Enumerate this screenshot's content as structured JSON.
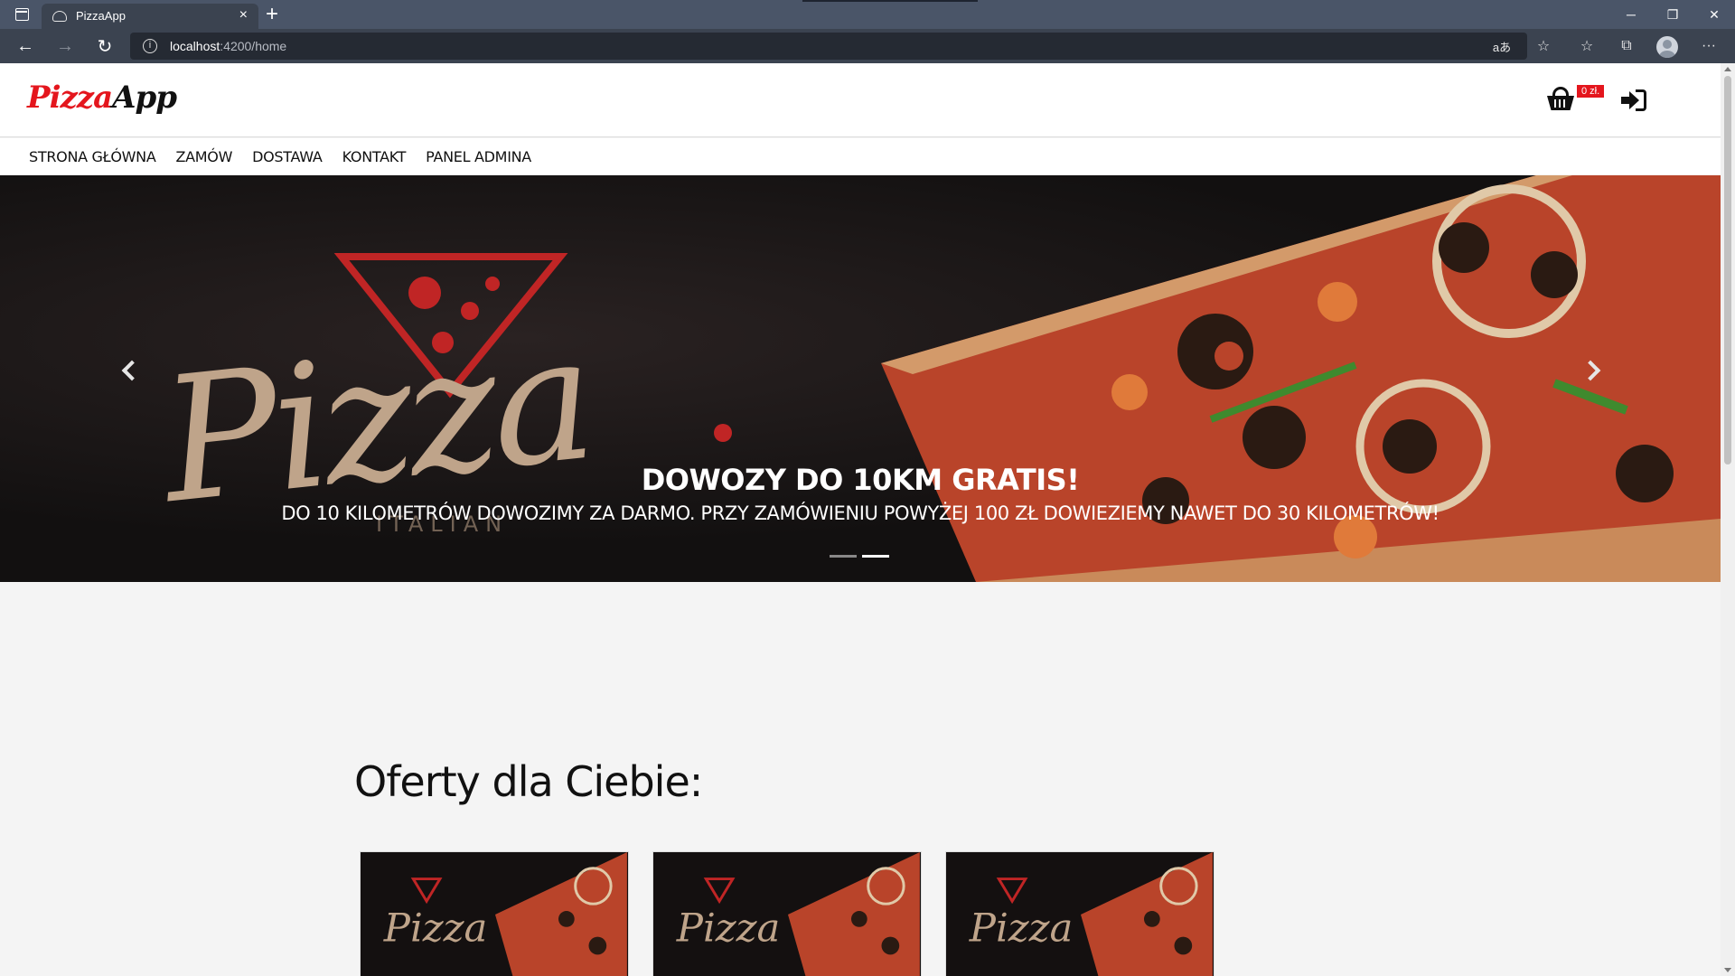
{
  "browser": {
    "tab_title": "PizzaApp",
    "tab_close": "×",
    "new_tab": "+",
    "url_host": "localhost",
    "url_path": ":4200/home",
    "window_controls": [
      "─",
      "❐",
      "✕"
    ],
    "nav_buttons": {
      "back": "←",
      "forward": "→",
      "refresh": "↻"
    },
    "right_icons": [
      "aあ",
      "☆",
      "☆",
      "⧉",
      "···"
    ]
  },
  "header": {
    "logo_part1": "Pizza",
    "logo_part2": "App",
    "cart_badge": "0 zł."
  },
  "nav": {
    "items": [
      "STRONA GŁÓWNA",
      "ZAMÓW",
      "DOSTAWA",
      "KONTAKT",
      "PANEL ADMINA"
    ]
  },
  "carousel": {
    "image_word": "Pizza",
    "image_subword": "ITALIAN",
    "title": "DOWOZY DO 10KM GRATIS!",
    "text": "DO 10 KILOMETRÓW DOWOZIMY ZA DARMO. PRZY ZAMÓWIENIU POWYŻEJ 100 ZŁ DOWIEZIEMY NAWET DO 30 KILOMETRÓW!",
    "slides": 2,
    "active_slide": 2
  },
  "offers": {
    "title": "Oferty dla Ciebie:",
    "card_count": 3
  },
  "colors": {
    "brand_red": "#e4161d",
    "hero_bg": "#141010",
    "tan": "#bfa48a"
  }
}
